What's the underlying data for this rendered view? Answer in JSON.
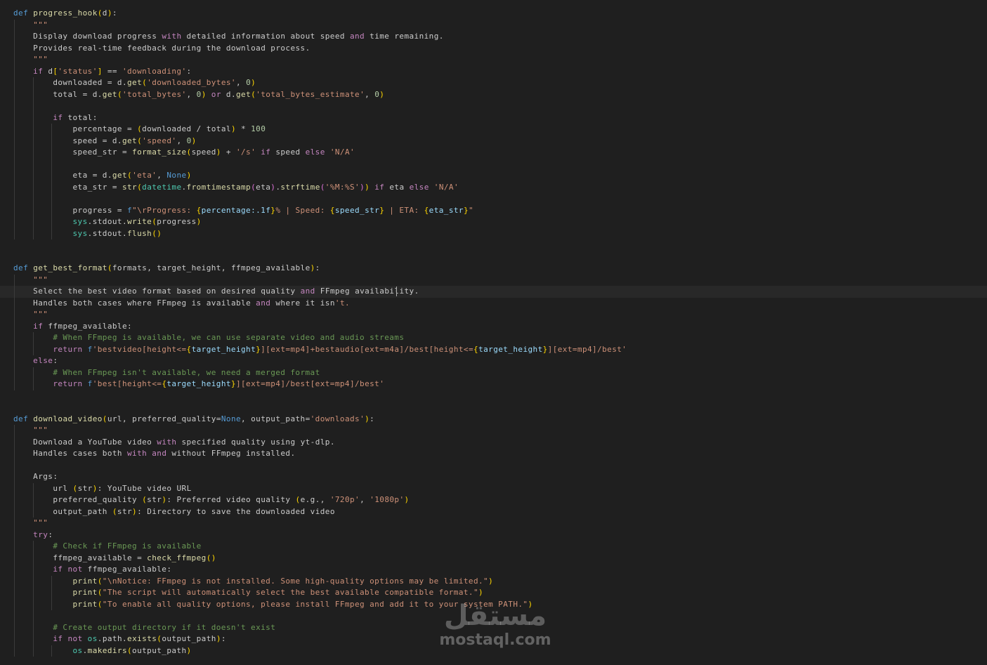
{
  "editor": {
    "language": "python",
    "current_line": 24,
    "indent_chars": 4,
    "colors": {
      "background": "#1f1f1f",
      "current_line": "#282828",
      "keyword": "#c586c0",
      "def": "#569cd6",
      "function": "#dcdcaa",
      "string": "#ce9178",
      "comment": "#6a9955",
      "number": "#b5cea8",
      "param": "#9cdcfe",
      "text": "#cccccc"
    },
    "lines": [
      "def progress_hook(d):",
      "    \"\"\"",
      "    Display download progress with detailed information about speed and time remaining.",
      "    Provides real-time feedback during the download process.",
      "    \"\"\"",
      "    if d['status'] == 'downloading':",
      "        downloaded = d.get('downloaded_bytes', 0)",
      "        total = d.get('total_bytes', 0) or d.get('total_bytes_estimate', 0)",
      "",
      "        if total:",
      "            percentage = (downloaded / total) * 100",
      "            speed = d.get('speed', 0)",
      "            speed_str = format_size(speed) + '/s' if speed else 'N/A'",
      "",
      "            eta = d.get('eta', None)",
      "            eta_str = str(datetime.fromtimestamp(eta).strftime('%M:%S')) if eta else 'N/A'",
      "",
      "            progress = f\"\\rProgress: {percentage:.1f}% | Speed: {speed_str} | ETA: {eta_str}\"",
      "            sys.stdout.write(progress)",
      "            sys.stdout.flush()",
      "",
      "",
      "def get_best_format(formats, target_height, ffmpeg_available):",
      "    \"\"\"",
      "    Select the best video format based on desired quality and FFmpeg availability.",
      "    Handles both cases where FFmpeg is available and where it isn't.",
      "    \"\"\"",
      "    if ffmpeg_available:",
      "        # When FFmpeg is available, we can use separate video and audio streams",
      "        return f'bestvideo[height<={target_height}][ext=mp4]+bestaudio[ext=m4a]/best[height<={target_height}][ext=mp4]/best'",
      "    else:",
      "        # When FFmpeg isn't available, we need a merged format",
      "        return f'best[height<={target_height}][ext=mp4]/best[ext=mp4]/best'",
      "",
      "",
      "def download_video(url, preferred_quality=None, output_path='downloads'):",
      "    \"\"\"",
      "    Download a YouTube video with specified quality using yt-dlp.",
      "    Handles cases both with and without FFmpeg installed.",
      "",
      "    Args:",
      "        url (str): YouTube video URL",
      "        preferred_quality (str): Preferred video quality (e.g., '720p', '1080p')",
      "        output_path (str): Directory to save the downloaded video",
      "    \"\"\"",
      "    try:",
      "        # Check if FFmpeg is available",
      "        ffmpeg_available = check_ffmpeg()",
      "        if not ffmpeg_available:",
      "            print(\"\\nNotice: FFmpeg is not installed. Some high-quality options may be limited.\")",
      "            print(\"The script will automatically select the best available compatible format.\")",
      "            print(\"To enable all quality options, please install FFmpeg and add it to your system PATH.\")",
      "",
      "        # Create output directory if it doesn't exist",
      "        if not os.path.exists(output_path):",
      "            os.makedirs(output_path)"
    ]
  },
  "watermark": {
    "arabic": "مستقل",
    "latin": "mostaql.com"
  }
}
